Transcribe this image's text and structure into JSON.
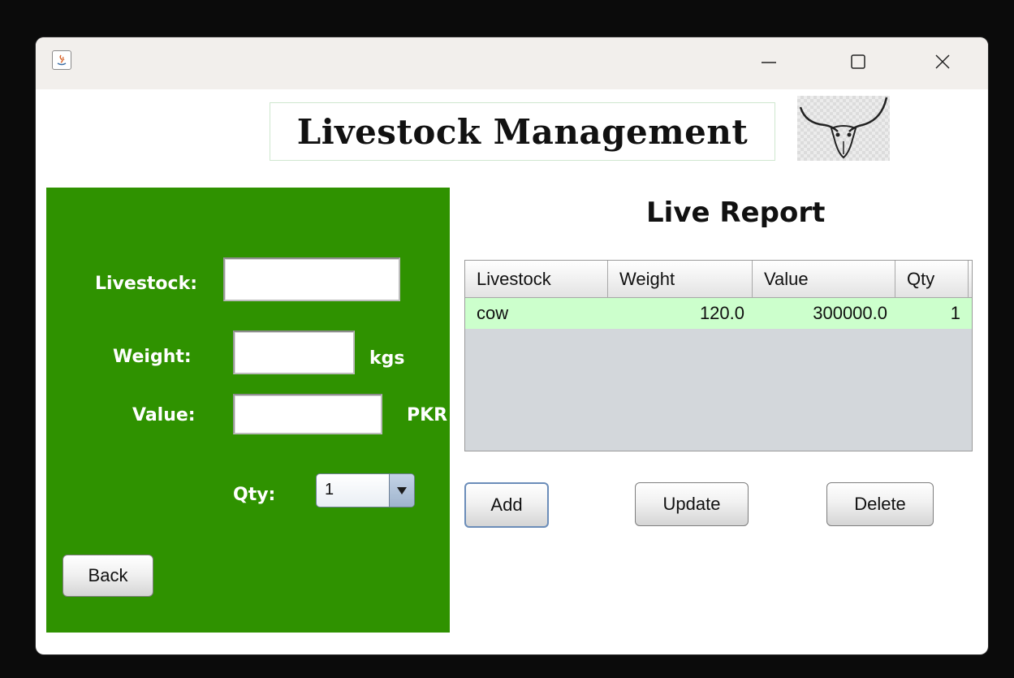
{
  "window": {
    "controls": {
      "minimize_icon": "minimize-icon",
      "maximize_icon": "maximize-icon",
      "close_icon": "close-icon"
    }
  },
  "header": {
    "title": "Livestock Management",
    "logo": "bull-skull-logo"
  },
  "form": {
    "livestock_label": "Livestock:",
    "livestock_value": "",
    "weight_label": "Weight:",
    "weight_value": "",
    "weight_unit": "kgs",
    "value_label": "Value:",
    "value_value": "",
    "value_unit": "PKR",
    "qty_label": "Qty:",
    "qty_selected": "1",
    "back_label": "Back"
  },
  "report": {
    "title": "Live Report",
    "columns": [
      "Livestock",
      "Weight",
      "Value",
      "Qty"
    ],
    "rows": [
      [
        "cow",
        "120.0",
        "300000.0",
        "1"
      ]
    ]
  },
  "actions": {
    "add_label": "Add",
    "update_label": "Update",
    "delete_label": "Delete"
  },
  "colors": {
    "panel_green": "#2f9200",
    "row_highlight": "#ccffcc",
    "table_bg": "#d3d7db"
  }
}
